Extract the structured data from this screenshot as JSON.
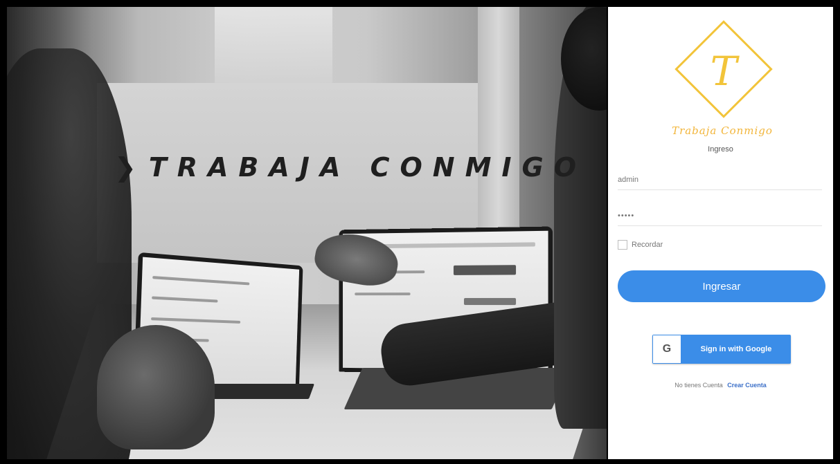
{
  "hero": {
    "title": "TRABAJA CONMIGO",
    "title_prefix_glyph": "❯"
  },
  "brand": {
    "logo_letter": "T",
    "logo_text": "Trabaja Conmigo",
    "accent_color": "#f2c43a"
  },
  "login": {
    "subtitle": "Ingreso",
    "username_value": "admin",
    "password_value": "•••••",
    "remember_label": "Recordar",
    "remember_checked": false,
    "submit_label": "Ingresar",
    "google_button_label": "Sign in with Google",
    "google_icon_letter": "G",
    "no_account_text": "No tienes Cuenta",
    "create_account_link": "Crear Cuenta",
    "primary_color": "#3b8de8"
  }
}
